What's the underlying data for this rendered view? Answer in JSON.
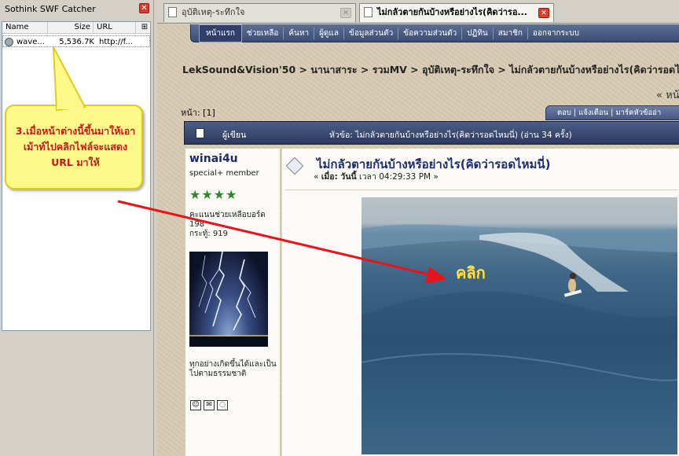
{
  "side_panel": {
    "title": "Sothink SWF Catcher",
    "close_glyph": "✕",
    "columns": [
      "Name",
      "Size",
      "URL",
      "⊞"
    ],
    "rows": [
      {
        "name": "wave...",
        "size": "5,536.7K",
        "url": "http://f..."
      }
    ]
  },
  "tabs": [
    {
      "label": "อุบัติเหตุ-ระทึกใจ",
      "active": false
    },
    {
      "label": "ไม่กลัวตายกันบ้างหรือย่างไร(คิดว่ารอ...",
      "active": true
    }
  ],
  "navbar": {
    "items": [
      "หน้าแรก",
      "ช่วยเหลือ",
      "ค้นหา",
      "ผู้ดูแล",
      "ข้อมูลส่วนตัว",
      "ข้อความส่วนตัว",
      "ปฏิทิน",
      "สมาชิก",
      "ออกจากระบบ"
    ]
  },
  "breadcrumb": "LekSound&Vision'50 > นานาสาระ > รวมMV > อุบัติเหตุ-ระทึกใจ > ไม่กลัวตายกันบ้างหรือย่างไร(คิดว่ารอดไหมนี่)",
  "pagenav_right": "« หน้",
  "page_label": "หน้า:",
  "page_number": "[1]",
  "action_bar": "ตอบ  |  แจ้งเตือน  |  มาร์คหัวข้ออ่า",
  "post_header": {
    "author_label": "ผู้เขียน",
    "subject": "หัวข้อ: ไม่กลัวตายกันบ้างหรือย่างไร(คิดว่ารอดไหมนี่)  (อ่าน 34 ครั้ง)"
  },
  "poster": {
    "name": "winai4u",
    "rank": "special+ member",
    "stars": "★★★★",
    "score_label": "คะแนนช่วยเหลือบอร์ด",
    "score_value": "198",
    "posts": "กระทู้: 919",
    "signature": "ทุกอย่างเกิดขึ้นได้และเป็นไปตามธรรมชาติ"
  },
  "post": {
    "title": "ไม่กลัวตายกันบ้างหรือย่างไร(คิดว่ารอดไหมนี่)",
    "date_prefix": "« ",
    "date_label": "เมื่อ: วันนี้",
    "date_value": " เวลา 04:29:33 PM »",
    "video_label": "คลิก"
  },
  "callout": {
    "text": "3.เมื่อหน้าต่างนี้ขึ้นมาให้เอาเม้าท์ไปคลิกไฟล์จะแสดง URL มาให้"
  },
  "colors": {
    "arrow": "#e8141c",
    "callout_bg": "#fdfa8a",
    "callout_text": "#c81818",
    "forum_header": "#3c4d73"
  }
}
